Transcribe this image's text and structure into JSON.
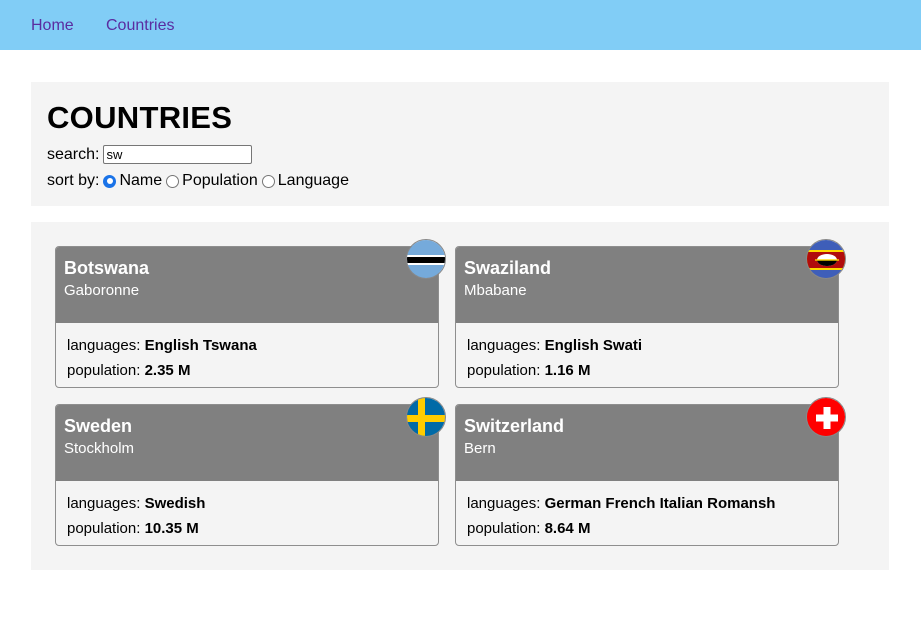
{
  "nav": {
    "home": "Home",
    "countries": "Countries"
  },
  "controls": {
    "title": "COUNTRIES",
    "search_label": "search:",
    "search_value": "sw",
    "sort_label": "sort by:",
    "sort_options": [
      "Name",
      "Population",
      "Language"
    ],
    "sort_selected": "Name"
  },
  "labels": {
    "languages": "languages:",
    "population": "population:"
  },
  "countries": [
    {
      "name": "Botswana",
      "capital": "Gaboronne",
      "languages": "English Tswana",
      "population": "2.35 M",
      "flag": "botswana-flag-icon"
    },
    {
      "name": "Swaziland",
      "capital": "Mbabane",
      "languages": "English Swati",
      "population": "1.16 M",
      "flag": "swaziland-flag-icon"
    },
    {
      "name": "Sweden",
      "capital": "Stockholm",
      "languages": "Swedish",
      "population": "10.35 M",
      "flag": "sweden-flag-icon"
    },
    {
      "name": "Switzerland",
      "capital": "Bern",
      "languages": "German French Italian Romansh",
      "population": "8.64 M",
      "flag": "switzerland-flag-icon"
    }
  ],
  "colors": {
    "nav_bg": "#81cdf6",
    "nav_link": "#5a2ca0",
    "card_head": "#808080",
    "panel_bg": "#f4f4f4"
  }
}
